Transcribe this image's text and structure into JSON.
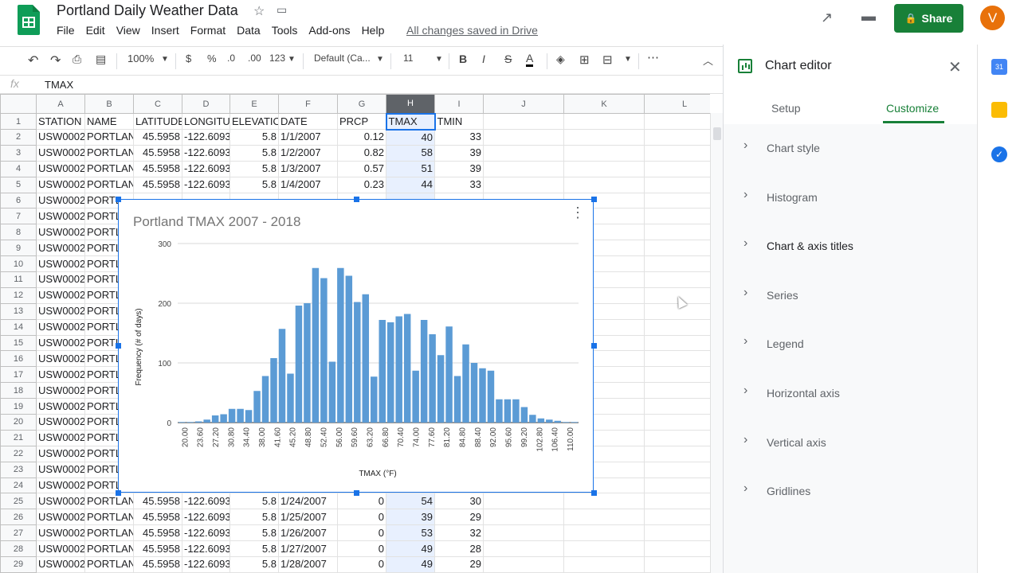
{
  "doc": {
    "title": "Portland Daily Weather Data",
    "saved_status": "All changes saved in Drive"
  },
  "menu": [
    "File",
    "Edit",
    "View",
    "Insert",
    "Format",
    "Data",
    "Tools",
    "Add-ons",
    "Help"
  ],
  "header": {
    "share_label": "Share",
    "avatar_letter": "V"
  },
  "toolbar": {
    "zoom": "100%",
    "currency": "$",
    "percent": "%",
    "dec_decrease": ".0",
    "dec_increase": ".00",
    "more_formats": "123",
    "font": "Default (Ca...",
    "font_size": "11",
    "bold": "B",
    "italic": "I",
    "strike": "S",
    "text_color": "A"
  },
  "formula": {
    "fx": "fx",
    "value": "TMAX"
  },
  "columns": [
    "A",
    "B",
    "C",
    "D",
    "E",
    "F",
    "G",
    "H",
    "I",
    "J",
    "K",
    "L"
  ],
  "rows": [
    [
      "1",
      "STATION",
      "NAME",
      "LATITUDE",
      "LONGITUD",
      "ELEVATIO",
      "DATE",
      "PRCP",
      "TMAX",
      "TMIN"
    ],
    [
      "2",
      "USW0002",
      "PORTLANI",
      "45.5958",
      "-122.6093",
      "5.8",
      "1/1/2007",
      "0.12",
      "40",
      "33"
    ],
    [
      "3",
      "USW0002",
      "PORTLANI",
      "45.5958",
      "-122.6093",
      "5.8",
      "1/2/2007",
      "0.82",
      "58",
      "39"
    ],
    [
      "4",
      "USW0002",
      "PORTLANI",
      "45.5958",
      "-122.6093",
      "5.8",
      "1/3/2007",
      "0.57",
      "51",
      "39"
    ],
    [
      "5",
      "USW0002",
      "PORTLANI",
      "45.5958",
      "-122.6093",
      "5.8",
      "1/4/2007",
      "0.23",
      "44",
      "33"
    ],
    [
      "6",
      "USW0002",
      "PORTL",
      "",
      "",
      "",
      "",
      "",
      "",
      ""
    ],
    [
      "7",
      "USW0002",
      "PORTL",
      "",
      "",
      "",
      "",
      "",
      "",
      ""
    ],
    [
      "8",
      "USW0002",
      "PORTL",
      "",
      "",
      "",
      "",
      "",
      "",
      ""
    ],
    [
      "9",
      "USW0002",
      "PORTL",
      "",
      "",
      "",
      "",
      "",
      "",
      ""
    ],
    [
      "10",
      "USW0002",
      "PORTL",
      "",
      "",
      "",
      "",
      "",
      "",
      ""
    ],
    [
      "11",
      "USW0002",
      "PORTL",
      "",
      "",
      "",
      "",
      "",
      "",
      ""
    ],
    [
      "12",
      "USW0002",
      "PORTL",
      "",
      "",
      "",
      "",
      "",
      "",
      ""
    ],
    [
      "13",
      "USW0002",
      "PORTL",
      "",
      "",
      "",
      "",
      "",
      "",
      ""
    ],
    [
      "14",
      "USW0002",
      "PORTL",
      "",
      "",
      "",
      "",
      "",
      "",
      ""
    ],
    [
      "15",
      "USW0002",
      "PORTL",
      "",
      "",
      "",
      "",
      "",
      "",
      ""
    ],
    [
      "16",
      "USW0002",
      "PORTL",
      "",
      "",
      "",
      "",
      "",
      "",
      ""
    ],
    [
      "17",
      "USW0002",
      "PORTL",
      "",
      "",
      "",
      "",
      "",
      "",
      ""
    ],
    [
      "18",
      "USW0002",
      "PORTL",
      "",
      "",
      "",
      "",
      "",
      "",
      ""
    ],
    [
      "19",
      "USW0002",
      "PORTL",
      "",
      "",
      "",
      "",
      "",
      "",
      ""
    ],
    [
      "20",
      "USW0002",
      "PORTL",
      "",
      "",
      "",
      "",
      "",
      "",
      ""
    ],
    [
      "21",
      "USW0002",
      "PORTL",
      "",
      "",
      "",
      "",
      "",
      "",
      ""
    ],
    [
      "22",
      "USW0002",
      "PORTL",
      "",
      "",
      "",
      "",
      "",
      "",
      ""
    ],
    [
      "23",
      "USW0002",
      "PORTL",
      "",
      "",
      "",
      "",
      "",
      "",
      ""
    ],
    [
      "24",
      "USW0002",
      "PORTL",
      "",
      "",
      "",
      "",
      "",
      "",
      ""
    ],
    [
      "25",
      "USW0002",
      "PORTLANI",
      "45.5958",
      "-122.6093",
      "5.8",
      "1/24/2007",
      "0",
      "54",
      "30"
    ],
    [
      "26",
      "USW0002",
      "PORTLANI",
      "45.5958",
      "-122.6093",
      "5.8",
      "1/25/2007",
      "0",
      "39",
      "29"
    ],
    [
      "27",
      "USW0002",
      "PORTLANI",
      "45.5958",
      "-122.6093",
      "5.8",
      "1/26/2007",
      "0",
      "53",
      "32"
    ],
    [
      "28",
      "USW0002",
      "PORTLANI",
      "45.5958",
      "-122.6093",
      "5.8",
      "1/27/2007",
      "0",
      "49",
      "28"
    ],
    [
      "29",
      "USW0002",
      "PORTLANI",
      "45.5958",
      "-122.6093",
      "5.8",
      "1/28/2007",
      "0",
      "49",
      "29"
    ]
  ],
  "chart_data": {
    "type": "bar",
    "title": "Portland TMAX 2007 - 2018",
    "xlabel": "TMAX (°F)",
    "ylabel": "Frequency (# of days)",
    "ylim": [
      0,
      300
    ],
    "yticks": [
      "0",
      "100",
      "200",
      "300"
    ],
    "xticks": [
      "20.00",
      "23.60",
      "27.20",
      "30.80",
      "34.40",
      "38.00",
      "41.60",
      "45.20",
      "48.80",
      "52.40",
      "56.00",
      "59.60",
      "63.20",
      "66.80",
      "70.40",
      "74.00",
      "77.60",
      "81.20",
      "84.80",
      "88.40",
      "92.00",
      "95.60",
      "99.20",
      "102.80",
      "106.40",
      "110.00"
    ],
    "values": [
      1,
      1,
      2,
      5,
      12,
      14,
      23,
      23,
      21,
      53,
      78,
      108,
      157,
      82,
      196,
      200,
      259,
      242,
      102,
      259,
      246,
      202,
      215,
      77,
      172,
      168,
      178,
      182,
      87,
      172,
      148,
      113,
      161,
      78,
      131,
      100,
      91,
      87,
      39,
      39,
      39,
      26,
      13,
      7,
      5,
      3,
      1,
      1
    ],
    "grid": true,
    "color": "#5b9bd5"
  },
  "panel": {
    "title": "Chart editor",
    "tabs": [
      "Setup",
      "Customize"
    ],
    "active_tab": "Customize",
    "sections": [
      "Chart style",
      "Histogram",
      "Chart & axis titles",
      "Series",
      "Legend",
      "Horizontal axis",
      "Vertical axis",
      "Gridlines"
    ]
  },
  "colors": {
    "accent": "#188038",
    "selection": "#1a73e8",
    "bar": "#5b9bd5",
    "avatar": "#e8710a"
  }
}
